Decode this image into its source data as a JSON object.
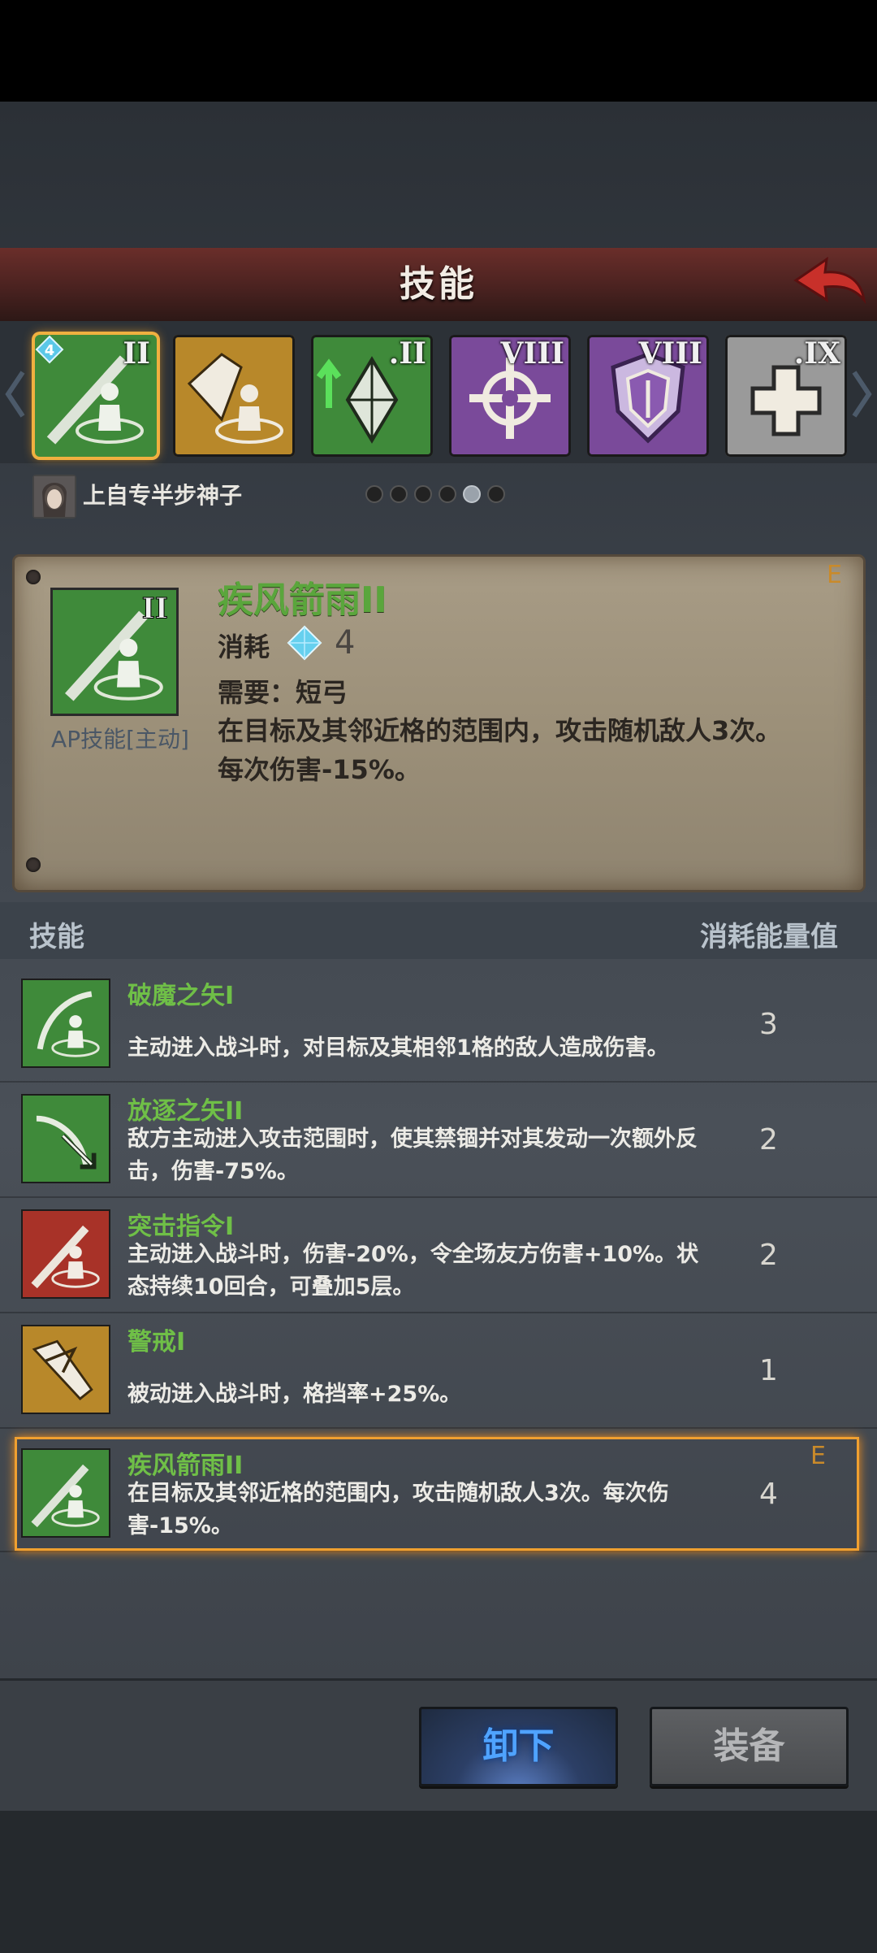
{
  "header": {
    "title": "技能"
  },
  "slots": [
    {
      "icon": "bow-stance-icon",
      "rank": "II",
      "bg": "#3f8a3a",
      "ap": "4"
    },
    {
      "icon": "shield-bash-icon",
      "rank": "",
      "bg": "#b8882a"
    },
    {
      "icon": "crystal-up-icon",
      "rank": ".II",
      "bg": "#3f8a3a"
    },
    {
      "icon": "crosshair-icon",
      "rank": "VIII",
      "bg": "#7a4a9a"
    },
    {
      "icon": "shield-icon",
      "rank": "VIII",
      "bg": "#7a4a9a"
    },
    {
      "icon": "cross-icon",
      "rank": ".IX",
      "bg": "#9a9a9a"
    }
  ],
  "owner": {
    "name": "上自专半步神子"
  },
  "detail": {
    "title": "疾风箭雨II",
    "category": "AP技能[主动]",
    "cost_label": "消耗",
    "cost_value": "4",
    "require": "需要：短弓",
    "description": "在目标及其邻近格的范围内，攻击随机敌人3次。每次伤害-15%。",
    "equipped_mark": "E"
  },
  "list": {
    "header_skill": "技能",
    "header_cost": "消耗能量值",
    "items": [
      {
        "name": "破魔之矢I",
        "desc": "主动进入战斗时，对目标及其相邻1格的敌人造成伤害。",
        "cost": "3",
        "bg": "#3f8a3a"
      },
      {
        "name": "放逐之矢II",
        "desc": "敌方主动进入攻击范围时，使其禁锢并对其发动一次额外反击，伤害-75%。",
        "cost": "2",
        "bg": "#3f8a3a"
      },
      {
        "name": "突击指令I",
        "desc": "主动进入战斗时，伤害-20%，令全场友方伤害+10%。状态持续10回合，可叠加5层。",
        "cost": "2",
        "bg": "#a83228"
      },
      {
        "name": "警戒I",
        "desc": "被动进入战斗时，格挡率+25%。",
        "cost": "1",
        "bg": "#b8882a"
      },
      {
        "name": "疾风箭雨II",
        "desc": "在目标及其邻近格的范围内，攻击随机敌人3次。每次伤害-15%。",
        "cost": "4",
        "bg": "#3f8a3a",
        "equipped_mark": "E"
      }
    ]
  },
  "buttons": {
    "unequip": "卸下",
    "equip": "装备"
  },
  "colors": {
    "accent": "#f0a030",
    "skill_name": "#6fbf47"
  }
}
